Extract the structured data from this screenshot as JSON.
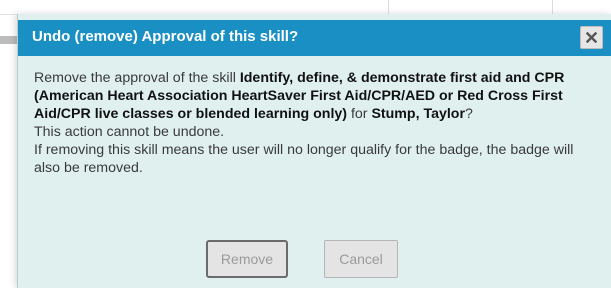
{
  "dialog": {
    "title": "Undo (remove) Approval of this skill?",
    "close_icon": "close-icon",
    "body": {
      "intro": "Remove the approval of the skill ",
      "skill_name": "Identify, define, & demonstrate first aid and CPR (American Heart Association HeartSaver First Aid/CPR/AED or Red Cross First Aid/CPR live classes or blended learning only)",
      "for_text": " for ",
      "user_name": "Stump, Taylor",
      "question_mark": "?",
      "warning": "This action cannot be undone.",
      "note": "If removing this skill means the user will no longer qualify for the badge, the badge will also be removed."
    },
    "buttons": {
      "remove_label": "Remove",
      "cancel_label": "Cancel"
    },
    "colors": {
      "header": "#1a8fc3",
      "dialog_background": "#dff0ef",
      "title_text": "#ffffff"
    }
  }
}
